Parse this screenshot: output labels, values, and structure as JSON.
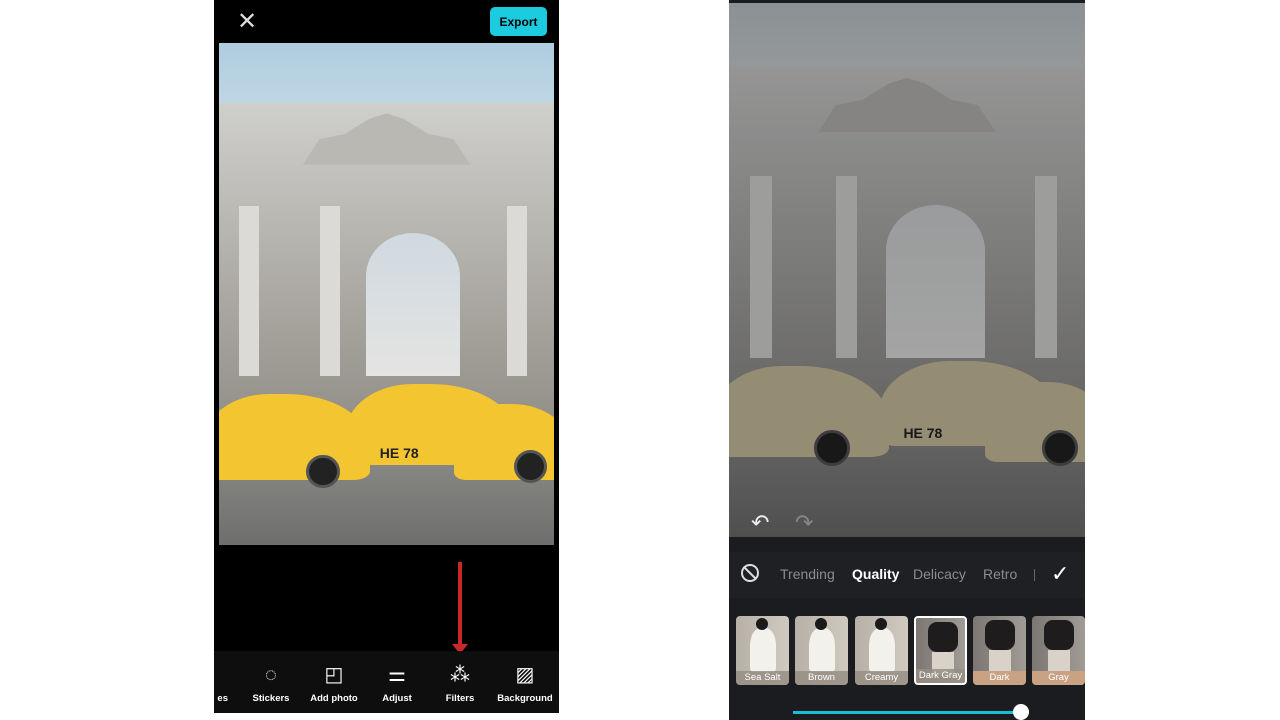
{
  "left_screen": {
    "export_label": "Export",
    "close_icon": "close-icon",
    "tools": [
      {
        "label": "es",
        "icon": "frame-icon"
      },
      {
        "label": "Stickers",
        "icon": "sticker-icon"
      },
      {
        "label": "Add photo",
        "icon": "add-photo-icon"
      },
      {
        "label": "Adjust",
        "icon": "sliders-icon"
      },
      {
        "label": "Filters",
        "icon": "filters-icon"
      },
      {
        "label": "Background",
        "icon": "background-icon"
      }
    ],
    "photo_plate": "HE 78",
    "annotation_color": "#c8282a"
  },
  "right_screen": {
    "photo_plate": "HE 78",
    "tabs": [
      {
        "label": "Trending",
        "active": false
      },
      {
        "label": "Quality",
        "active": true
      },
      {
        "label": "Delicacy",
        "active": false
      },
      {
        "label": "Retro",
        "active": false
      }
    ],
    "filters": [
      {
        "label": "Sea Salt",
        "selected": false
      },
      {
        "label": "Brown",
        "selected": false
      },
      {
        "label": "Creamy",
        "selected": false
      },
      {
        "label": "Dark Gray",
        "selected": true
      },
      {
        "label": "Dark",
        "selected": false
      },
      {
        "label": "Gray",
        "selected": false
      }
    ],
    "intensity_percent": 100,
    "accent_color": "#16c1d6"
  }
}
